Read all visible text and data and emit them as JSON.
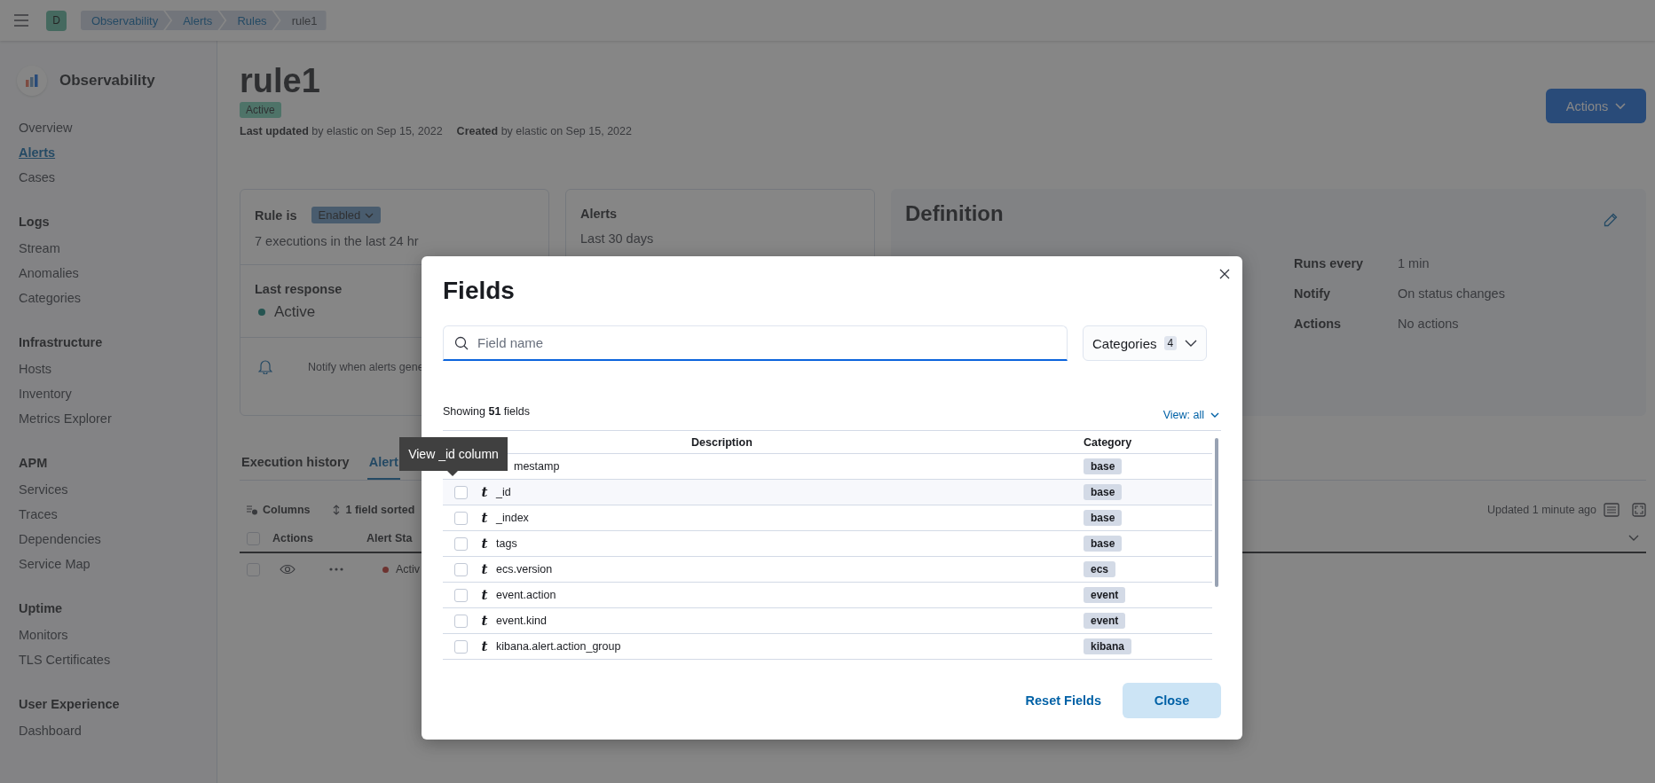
{
  "top_bar": {
    "avatar": "D",
    "breadcrumbs": [
      {
        "label": "Observability",
        "selected": false
      },
      {
        "label": "Alerts",
        "selected": false
      },
      {
        "label": "Rules",
        "selected": false
      },
      {
        "label": "rule1",
        "selected": true
      }
    ]
  },
  "sidebar": {
    "title": "Observability",
    "sections": [
      {
        "items": [
          {
            "label": "Overview",
            "selected": false
          },
          {
            "label": "Alerts",
            "selected": true
          },
          {
            "label": "Cases",
            "selected": false
          }
        ]
      },
      {
        "heading": "Logs",
        "items": [
          {
            "label": "Stream",
            "selected": false
          },
          {
            "label": "Anomalies",
            "selected": false
          },
          {
            "label": "Categories",
            "selected": false
          }
        ]
      },
      {
        "heading": "Infrastructure",
        "items": [
          {
            "label": "Hosts",
            "selected": false
          },
          {
            "label": "Inventory",
            "selected": false
          },
          {
            "label": "Metrics Explorer",
            "selected": false
          }
        ]
      },
      {
        "heading": "APM",
        "items": [
          {
            "label": "Services",
            "selected": false
          },
          {
            "label": "Traces",
            "selected": false
          },
          {
            "label": "Dependencies",
            "selected": false
          },
          {
            "label": "Service Map",
            "selected": false
          }
        ]
      },
      {
        "heading": "Uptime",
        "items": [
          {
            "label": "Monitors",
            "selected": false
          },
          {
            "label": "TLS Certificates",
            "selected": false
          }
        ]
      },
      {
        "heading": "User Experience",
        "items": [
          {
            "label": "Dashboard",
            "selected": false
          }
        ]
      }
    ]
  },
  "header": {
    "title": "rule1",
    "badge": "Active",
    "meta": [
      "**Last updated** by elastic on Sep 15, 2022",
      "**Created** by elastic on Sep 15, 2022"
    ],
    "actions_button": "Actions"
  },
  "status_card": {
    "label": "Rule is",
    "status": "Enabled",
    "executions": "7 executions in the last 24 hr",
    "last_response_label": "Last response",
    "last_response": "Active",
    "notify": "Notify when alerts gene"
  },
  "alerts_card": {
    "title": "Alerts",
    "subtitle": "Last 30 days"
  },
  "definition": {
    "title": "Definition",
    "rows": [
      {
        "label": "Runs every",
        "value": "1 min"
      },
      {
        "label": "Notify",
        "value": "On status changes"
      },
      {
        "label": "Actions",
        "value": "No actions"
      }
    ]
  },
  "tabs": [
    {
      "label": "Execution history",
      "selected": false
    },
    {
      "label": "Alert",
      "selected": true
    }
  ],
  "alerts_table": {
    "columns_button": "Columns",
    "sorted_button": "1 field sorted",
    "updated": "Updated 1 minute ago",
    "header_checked": false,
    "columns": [
      "Actions",
      "Alert Sta"
    ],
    "rows": [
      {
        "status": "Activ",
        "checked": false
      }
    ]
  },
  "fields_modal": {
    "title": "Fields",
    "search": {
      "placeholder": "Field name"
    },
    "categories_button": {
      "label": "Categories",
      "count": "4"
    },
    "showing": "Showing **51** fields",
    "view_button": "View: all",
    "columns": [
      "Description",
      "Category"
    ],
    "rows": [
      {
        "name": "mestamp",
        "category": "base"
      },
      {
        "type": "t",
        "name": "_id",
        "category": "base",
        "checked": false
      },
      {
        "type": "t",
        "name": "_index",
        "category": "base",
        "checked": false
      },
      {
        "type": "t",
        "name": "tags",
        "category": "base",
        "checked": false
      },
      {
        "type": "t",
        "name": "ecs.version",
        "category": "ecs",
        "checked": false
      },
      {
        "type": "t",
        "name": "event.action",
        "category": "event",
        "checked": false
      },
      {
        "type": "t",
        "name": "event.kind",
        "category": "event",
        "checked": false
      },
      {
        "type": "t",
        "name": "kibana.alert.action_group",
        "category": "kibana",
        "checked": false
      }
    ],
    "reset_button": "Reset Fields",
    "close_button": "Close"
  },
  "tooltip": "View _id column"
}
